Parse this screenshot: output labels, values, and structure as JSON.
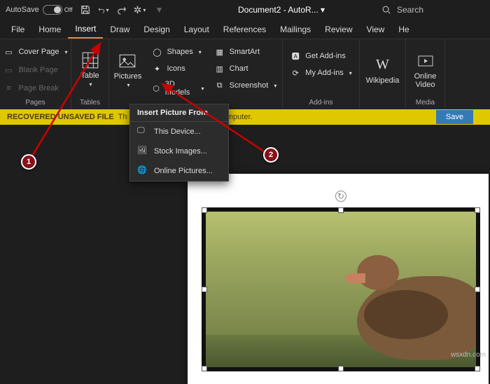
{
  "title": {
    "autosave": "AutoSave",
    "autosave_state": "Off",
    "doc": "Document2 - AutoR... ▾",
    "search": "Search"
  },
  "tabs": [
    "File",
    "Home",
    "Insert",
    "Draw",
    "Design",
    "Layout",
    "References",
    "Mailings",
    "Review",
    "View",
    "He"
  ],
  "active_tab": 2,
  "ribbon": {
    "pages": {
      "label": "Pages",
      "cover": "Cover Page",
      "blank": "Blank Page",
      "break": "Page Break"
    },
    "tables": {
      "label": "Tables",
      "table": "Table"
    },
    "illus": {
      "pictures": "Pictures",
      "shapes": "Shapes",
      "icons": "Icons",
      "models": "3D Models"
    },
    "addins_top": {
      "smartart": "SmartArt",
      "chart": "Chart",
      "screenshot": "Screenshot"
    },
    "addins": {
      "label": "Add-ins",
      "get": "Get Add-ins",
      "my": "My Add-ins"
    },
    "wiki": "Wikipedia",
    "media": {
      "label": "Media",
      "video": "Online\nVideo"
    }
  },
  "bar": {
    "bold": "RECOVERED UNSAVED FILE",
    "text": "Th                                         emporarily stored on your computer.",
    "save": "Save"
  },
  "menu": {
    "head": "Insert Picture From",
    "device": "This Device...",
    "stock": "Stock Images...",
    "online": "Online Pictures..."
  },
  "callouts": {
    "one": "1",
    "two": "2"
  },
  "watermark": "wsxdn.com"
}
